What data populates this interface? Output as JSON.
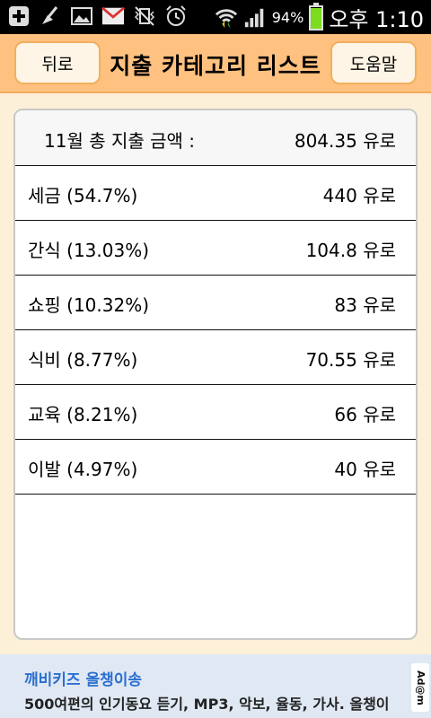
{
  "status_bar": {
    "battery_percent": "94%",
    "battery_level": 0.94,
    "time": "오후 1:10",
    "icons": [
      "add-icon",
      "broom-icon",
      "image-icon",
      "gmail-icon",
      "no-vibrate-icon",
      "alarm-icon",
      "wifi-icon",
      "signal-icon",
      "battery-icon"
    ]
  },
  "header": {
    "back_label": "뒤로",
    "title": "지출 카테고리 리스트",
    "help_label": "도움말"
  },
  "summary": {
    "label": "11월 총 지출 금액 :",
    "value": "804.35 유로"
  },
  "categories": [
    {
      "name": "세금 (54.7%)",
      "amount": "440 유로"
    },
    {
      "name": "간식 (13.03%)",
      "amount": "104.8 유로"
    },
    {
      "name": "쇼핑 (10.32%)",
      "amount": "83 유로"
    },
    {
      "name": "식비 (8.77%)",
      "amount": "70.55 유로"
    },
    {
      "name": "교육 (8.21%)",
      "amount": "66 유로"
    },
    {
      "name": "이발 (4.97%)",
      "amount": "40 유로"
    }
  ],
  "ad": {
    "title": "깨비키즈 올챙이송",
    "description": "500여편의 인기동요 듣기, MP3, 악보, 율동, 가사. 올챙이",
    "logo": "Ad@m"
  },
  "colors": {
    "title_bar": "#ffc17f",
    "background": "#fdf0d8",
    "ad_title": "#2c6fd1",
    "battery": "#7ddc1f"
  }
}
